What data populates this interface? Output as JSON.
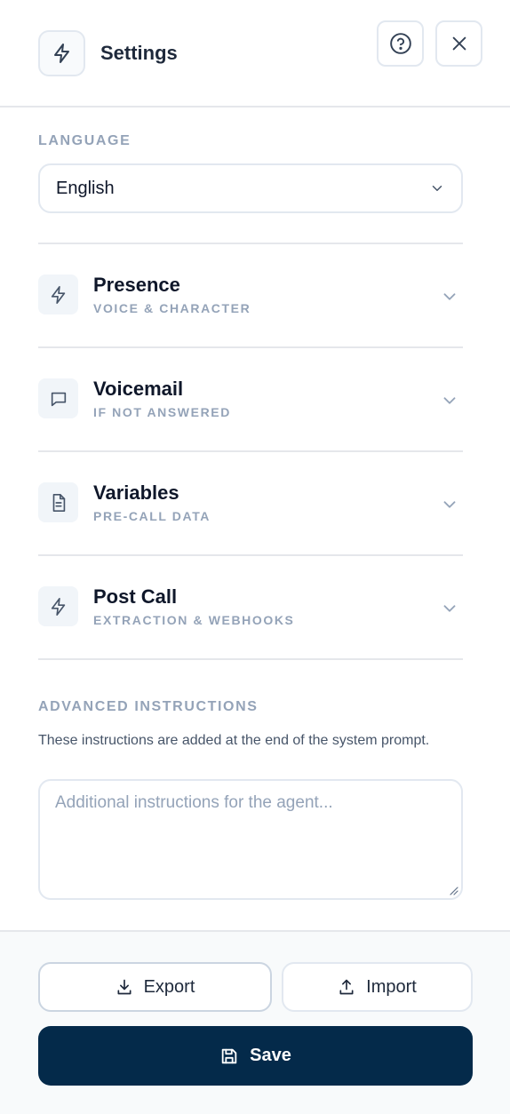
{
  "header": {
    "title": "Settings",
    "icon": "lightning-icon",
    "help_icon": "help-circle-icon",
    "close_icon": "close-icon"
  },
  "language": {
    "label": "LANGUAGE",
    "value": "English"
  },
  "sections": [
    {
      "title": "Presence",
      "subtitle": "VOICE & CHARACTER",
      "icon": "lightning-icon"
    },
    {
      "title": "Voicemail",
      "subtitle": "IF NOT ANSWERED",
      "icon": "message-square-icon"
    },
    {
      "title": "Variables",
      "subtitle": "PRE-CALL DATA",
      "icon": "file-text-icon"
    },
    {
      "title": "Post Call",
      "subtitle": "EXTRACTION & WEBHOOKS",
      "icon": "lightning-icon"
    }
  ],
  "advanced": {
    "label": "ADVANCED INSTRUCTIONS",
    "description": "These instructions are added at the end of the system prompt.",
    "value": "",
    "placeholder": "Additional instructions for the agent..."
  },
  "footer": {
    "export_label": "Export",
    "import_label": "Import",
    "save_label": "Save"
  },
  "colors": {
    "primary": "#042a4a",
    "muted": "#94a3b8",
    "border": "#e2e8f0"
  }
}
